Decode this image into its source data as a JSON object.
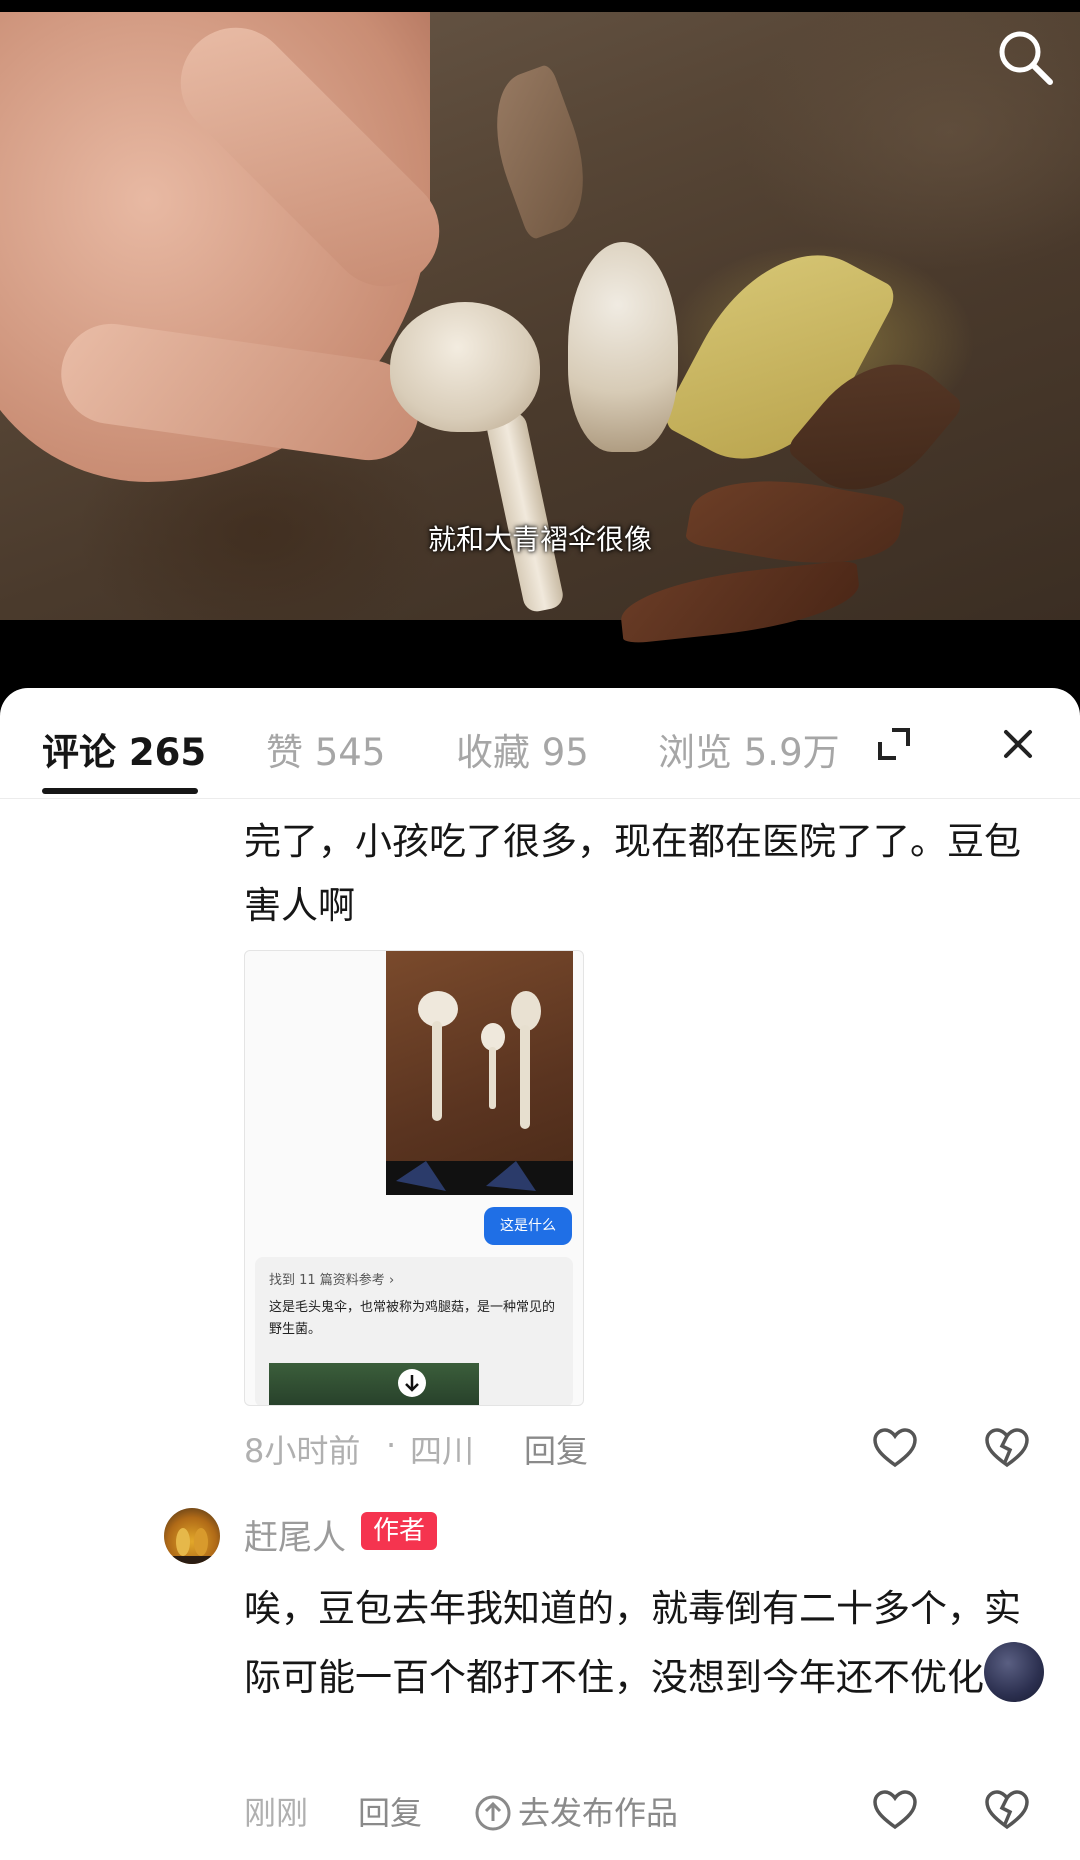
{
  "video": {
    "subtitle": "就和大青褶伞很像",
    "search_icon": "search-icon"
  },
  "tabs": [
    {
      "label": "评论 265"
    },
    {
      "label": "赞 545"
    },
    {
      "label": "收藏 95"
    },
    {
      "label": "浏览 5.9万"
    }
  ],
  "header_icons": {
    "expand": "expand-icon",
    "close": "close-icon"
  },
  "comment1": {
    "text": "完了，小孩吃了很多，现在都在医院了了。豆包害人啊",
    "time": "8小时前",
    "separator": "·",
    "location": "四川",
    "reply": "回复",
    "screenshot": {
      "bubble": "这是什么",
      "ref_title": "找到 11 篇资料参考 ›",
      "ref_body": "这是毛头鬼伞，也常被称为鸡腿菇，是一种常见的野生菌。"
    }
  },
  "comment2": {
    "author": "赶尾人",
    "badge": "作者",
    "text": "唉，豆包去年我知道的，就毒倒有二十多个，实际可能一百个都打不住，没想到今年还不优化",
    "time": "刚刚",
    "reply": "回复",
    "publish": "去发布作品"
  },
  "colors": {
    "badge": "#f5344f",
    "bubble": "#1f6fe6",
    "muted": "#b0b0b0",
    "text": "#161616"
  }
}
